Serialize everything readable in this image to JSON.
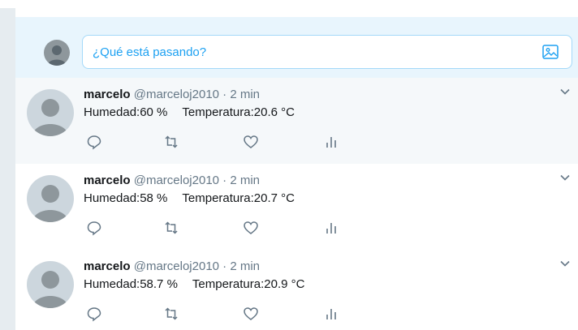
{
  "composer": {
    "placeholder": "¿Qué está pasando?",
    "accent": "#1da1f2"
  },
  "tweets": [
    {
      "name": "marcelo",
      "handle": "@marceloj2010",
      "separator": "·",
      "time": "2 min",
      "humidity": "Humedad:60 %",
      "temperature": "Temperatura:20.6 °C"
    },
    {
      "name": "marcelo",
      "handle": "@marceloj2010",
      "separator": "·",
      "time": "2 min",
      "humidity": "Humedad:58 %",
      "temperature": "Temperatura:20.7 °C"
    },
    {
      "name": "marcelo",
      "handle": "@marceloj2010",
      "separator": "·",
      "time": "2 min",
      "humidity": "Humedad:58.7 %",
      "temperature": "Temperatura:20.9 °C"
    }
  ],
  "icons": {
    "reply": "reply-icon",
    "retweet": "retweet-icon",
    "like": "heart-icon",
    "analytics": "analytics-icon",
    "more": "chevron-down-icon",
    "media": "image-icon"
  }
}
